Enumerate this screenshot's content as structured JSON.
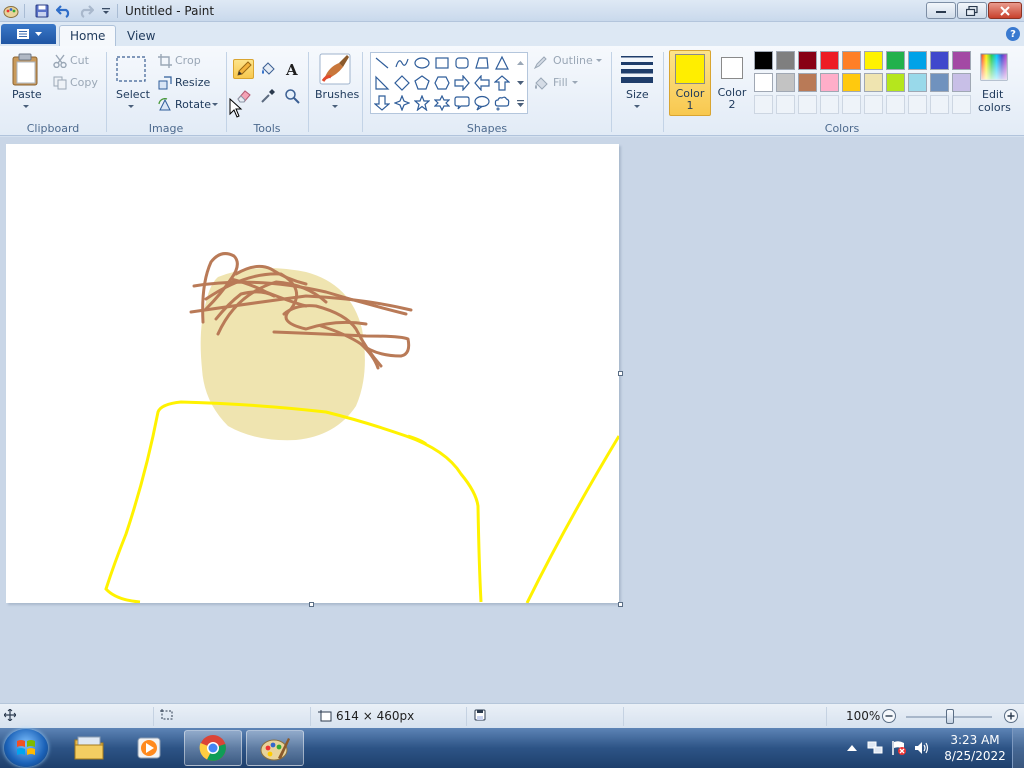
{
  "window": {
    "title": "Untitled - Paint"
  },
  "tabs": [
    {
      "label": "Home",
      "active": true
    },
    {
      "label": "View",
      "active": false
    }
  ],
  "clipboard": {
    "paste_label": "Paste",
    "cut_label": "Cut",
    "copy_label": "Copy",
    "group_label": "Clipboard"
  },
  "image": {
    "select_label": "Select",
    "crop_label": "Crop",
    "resize_label": "Resize",
    "rotate_label": "Rotate",
    "group_label": "Image"
  },
  "tools": {
    "group_label": "Tools",
    "items": [
      "pencil-icon",
      "fill-icon",
      "text-icon",
      "eraser-icon",
      "color-picker-icon",
      "magnifier-icon"
    ],
    "active": "pencil-icon"
  },
  "brushes": {
    "label": "Brushes"
  },
  "shapes": {
    "group_label": "Shapes",
    "outline_label": "Outline",
    "fill_label": "Fill",
    "items": [
      "line",
      "curve",
      "oval",
      "rectangle",
      "rounded-rectangle",
      "polygon",
      "triangle",
      "right-triangle",
      "diamond",
      "pentagon",
      "hexagon",
      "right-arrow",
      "left-arrow",
      "up-arrow",
      "down-arrow",
      "four-point-star",
      "five-point-star",
      "six-point-star",
      "rounded-callout",
      "oval-callout",
      "cloud-callout"
    ]
  },
  "size": {
    "label": "Size"
  },
  "colors": {
    "group_label": "Colors",
    "color1_label": "Color",
    "color1_num": "1",
    "color1_value": "#ffee00",
    "color2_label": "Color",
    "color2_num": "2",
    "color2_value": "#ffffff",
    "edit_label_1": "Edit",
    "edit_label_2": "colors",
    "palette_row1": [
      "#000000",
      "#7f7f7f",
      "#880015",
      "#ed1c24",
      "#ff7f27",
      "#fff200",
      "#22b14c",
      "#00a2e8",
      "#3f48cc",
      "#a349a4"
    ],
    "palette_row2": [
      "#ffffff",
      "#c3c3c3",
      "#b97a57",
      "#ffaec9",
      "#ffc90e",
      "#efe4b0",
      "#b5e61d",
      "#99d9ea",
      "#7092be",
      "#c8bfe7"
    ]
  },
  "drawing": {
    "face_color": "#efe4b0",
    "hair_color": "#b97a57",
    "body_color": "#fff200"
  },
  "statusbar": {
    "canvas_size": "614 × 460px",
    "zoom": "100%"
  },
  "taskbar": {
    "time": "3:23 AM",
    "date": "8/25/2022"
  }
}
